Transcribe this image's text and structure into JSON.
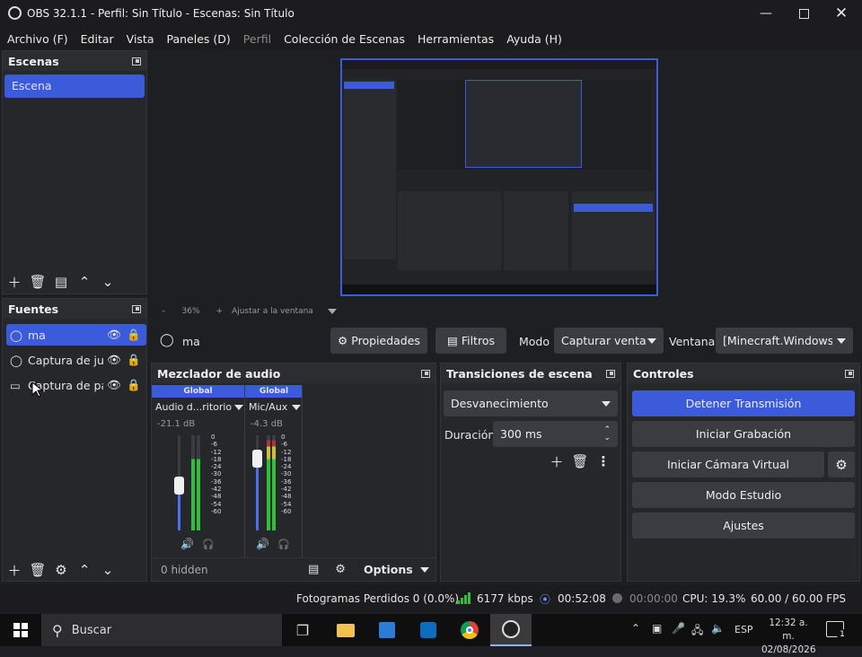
{
  "window": {
    "title": "OBS 32.1.1 - Perfil: Sin Título - Escenas: Sin Título"
  },
  "menu": [
    "Archivo (F)",
    "Editar",
    "Vista",
    "Paneles (D)",
    "Perfil",
    "Colección de Escenas",
    "Herramientas",
    "Ayuda (H)"
  ],
  "scenes": {
    "title": "Escenas",
    "items": [
      "Escena"
    ]
  },
  "sources": {
    "title": "Fuentes",
    "items": [
      "ma",
      "Captura de ju",
      "Captura de pa"
    ]
  },
  "preview_bar": {
    "zoom": "36%",
    "fit": "Ajustar a la ventana"
  },
  "source_bar": {
    "name": "ma",
    "props": "Propiedades",
    "filters": "Filtros",
    "mode_label": "Modo",
    "mode_value": "Capturar venta",
    "window_label": "Ventana",
    "window_value": "[Minecraft.Windows."
  },
  "mixer": {
    "title": "Mezclador de audio",
    "channels": [
      {
        "tag": "Global",
        "name": "Audio d...ritorio",
        "db": "-21.1 dB",
        "level": 0.75
      },
      {
        "tag": "Global",
        "name": "Mic/Aux",
        "db": "-4.3 dB",
        "level": 0.95
      }
    ],
    "scale": [
      "0",
      "-6",
      "-12",
      "-18",
      "-24",
      "-30",
      "-36",
      "-42",
      "-48",
      "-54",
      "-60"
    ],
    "hidden": "0 hidden",
    "options": "Options"
  },
  "transitions": {
    "title": "Transiciones de escena",
    "value": "Desvanecimiento",
    "duration_label": "Duración",
    "duration_value": "300 ms"
  },
  "controls": {
    "title": "Controles",
    "stop_stream": "Detener Transmisión",
    "start_record": "Iniciar Grabación",
    "start_virtualcam": "Iniciar Cámara Virtual",
    "studio_mode": "Modo Estudio",
    "settings": "Ajustes"
  },
  "statusbar": {
    "dropped": "Fotogramas Perdidos 0 (0.0%)",
    "bitrate": "6177 kbps",
    "stream_time": "00:52:08",
    "rec_time": "00:00:00",
    "cpu": "CPU: 19.3%",
    "fps": "60.00 / 60.00 FPS"
  },
  "taskbar": {
    "search_placeholder": "Buscar",
    "lang": "ESP",
    "time": "12:32 a. m.",
    "date": "02/08/2026",
    "notifications": "1"
  },
  "colors": {
    "accent": "#3b5bdb",
    "bg": "#1e1f22",
    "panel": "#26272b",
    "meter_green": "#2fbf3a",
    "meter_yellow": "#c9c22d",
    "meter_red": "#b2323a"
  }
}
